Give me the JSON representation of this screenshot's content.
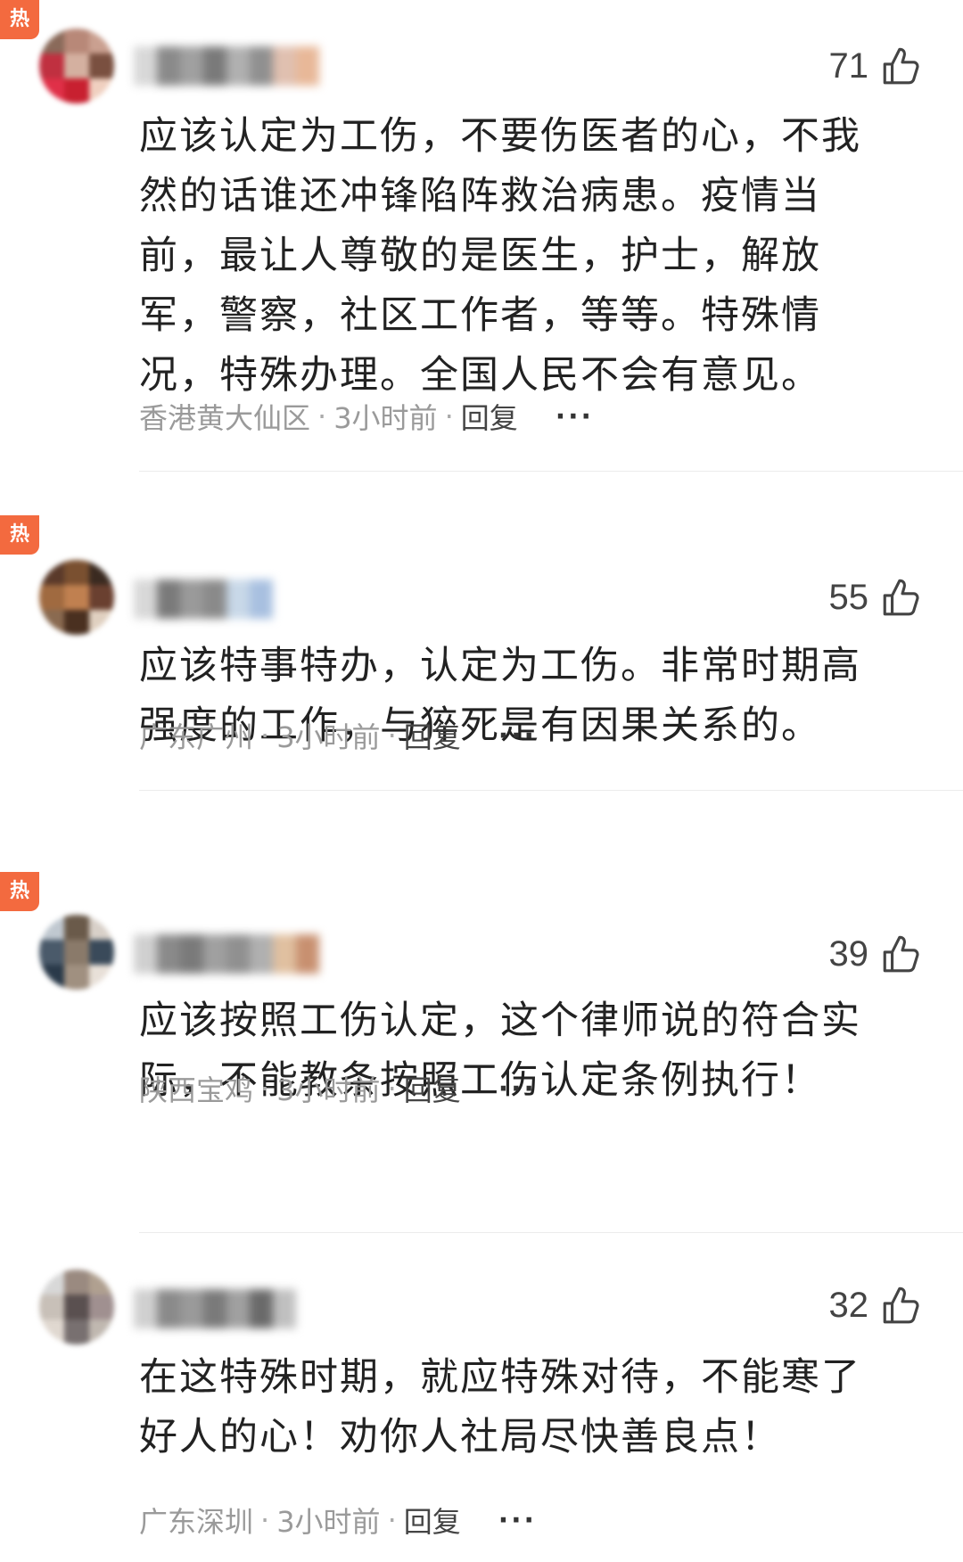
{
  "comments": [
    {
      "hot_label": "热",
      "like_count": "71",
      "text": "应该认定为工伤，不要伤医者的心，不我然的话谁还冲锋陷阵救治病患。疫情当前，最让人尊敬的是医生，护士，解放军，警察，社区工作者，等等。特殊情况，特殊办理。全国人民不会有意见。",
      "location": "香港黄大仙区",
      "time": "3小时前",
      "reply_label": "回复",
      "more_label": "···",
      "avatar_colors": [
        "#8a6a5a",
        "#b88878",
        "#caa090",
        "#c03040",
        "#d4b0a0",
        "#7a5040",
        "#e03048",
        "#c82030",
        "#f0d0c0"
      ],
      "username_colors": [
        "#d8d8d8",
        "#8a8a8a",
        "#a0a0a0",
        "#7a7a7a",
        "#b0b0b0",
        "#909090",
        "#e0c0b0",
        "#e8b898"
      ]
    },
    {
      "hot_label": "热",
      "like_count": "55",
      "text": "应该特事特办，认定为工伤。非常时期高强度的工作，与猝死是有因果关系的。",
      "location": "广东广州",
      "time": "3小时前",
      "reply_label": "回复",
      "more_label": "···",
      "avatar_colors": [
        "#5a3a2a",
        "#7a5030",
        "#3a2a20",
        "#a06a40",
        "#c08050",
        "#6a4030",
        "#8a6a50",
        "#4a3020",
        "#e0d0c0"
      ],
      "username_colors": [
        "#d8d8d8",
        "#7a7a7a",
        "#9a9a9a",
        "#8a8a8a",
        "#c8d8e8",
        "#a8c0e0"
      ]
    },
    {
      "hot_label": "热",
      "like_count": "39",
      "text": "应该按照工伤认定，这个律师说的符合实际，不能教条按照工伤认定条例执行！",
      "location": "陕西宝鸡",
      "time": "3小时前",
      "reply_label": "回复",
      "more_label": "···",
      "avatar_colors": [
        "#c0c8d0",
        "#6a5a4a",
        "#d8d0c8",
        "#4a5a6a",
        "#8a7a6a",
        "#3a4a5a",
        "#2a3a4a",
        "#a09080",
        "#e8e0d8"
      ],
      "username_colors": [
        "#d0d0d0",
        "#8a8a8a",
        "#7a7a7a",
        "#a0a0a0",
        "#909090",
        "#b0b0b0",
        "#e0c0a0",
        "#c89070"
      ]
    },
    {
      "hot_label": "",
      "like_count": "32",
      "text": "在这特殊时期，就应特殊对待，不能寒了好人的心！劝你人社局尽快善良点！",
      "location": "广东深圳",
      "time": "3小时前",
      "reply_label": "回复",
      "more_label": "···",
      "avatar_colors": [
        "#d8d8d8",
        "#9a8a80",
        "#b0a090",
        "#c8c0b8",
        "#5a5050",
        "#a09090",
        "#e0d8d0",
        "#787070",
        "#c0b8b0"
      ],
      "username_colors": [
        "#d0d0d0",
        "#8a8a8a",
        "#9a9a9a",
        "#7a7a7a",
        "#a0a0a0",
        "#6a6a6a",
        "#c0c0c0"
      ]
    }
  ]
}
